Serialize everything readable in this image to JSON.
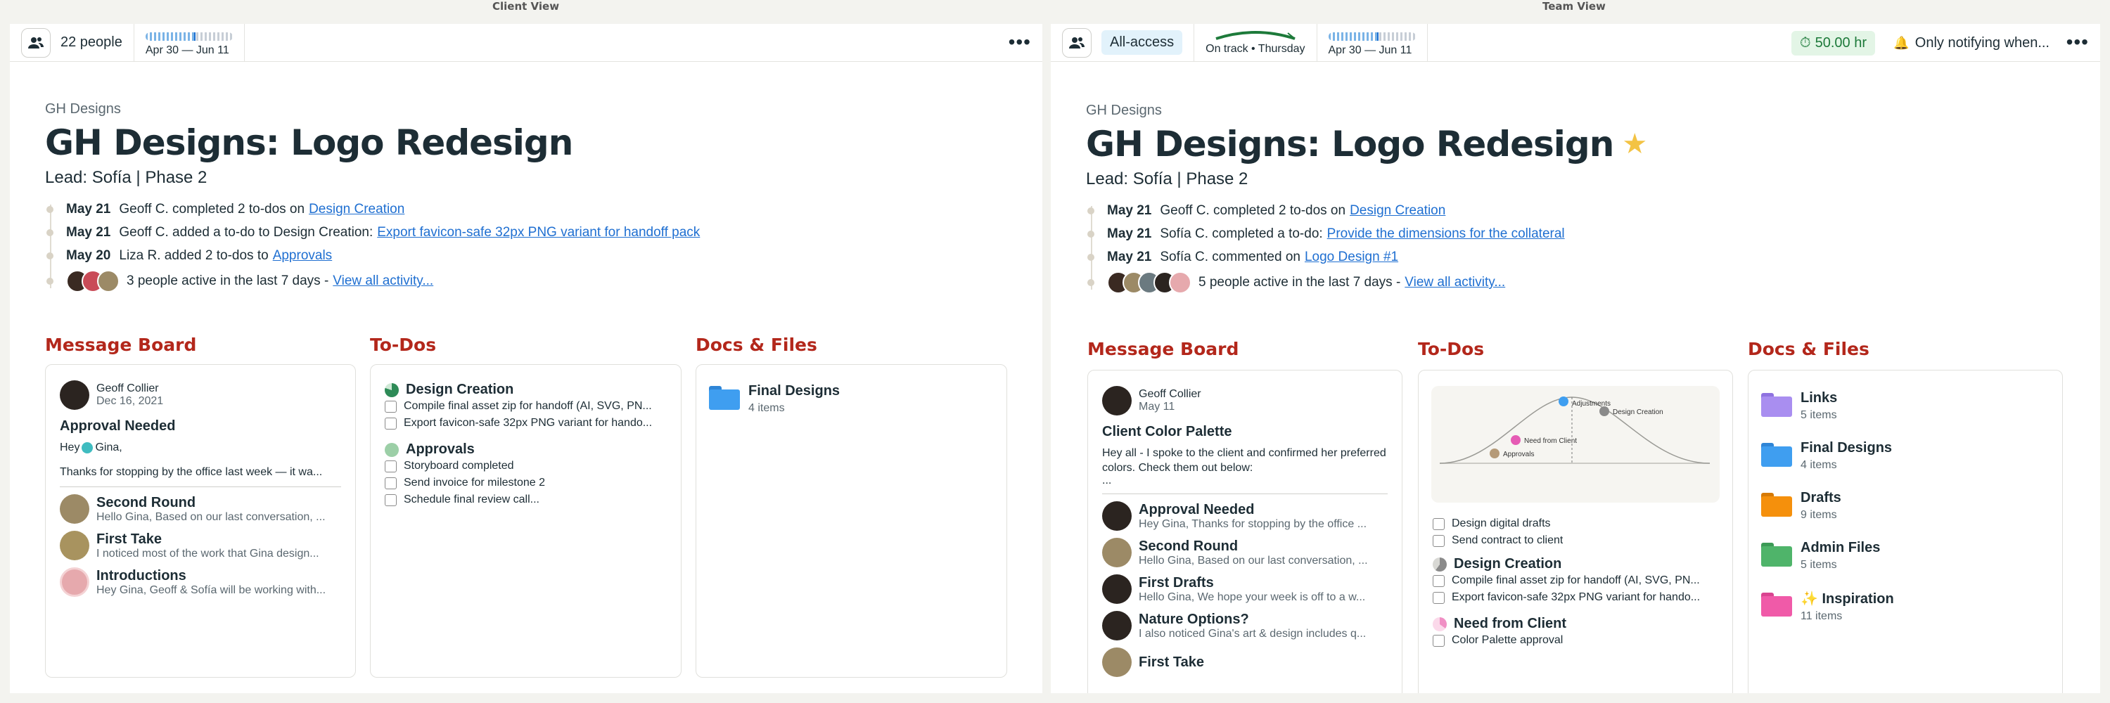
{
  "view_labels": {
    "client": "Client View",
    "team": "Team View"
  },
  "client": {
    "people": "22 people",
    "dates": "Apr 30 — Jun 11",
    "progress_fraction": 0.56,
    "company": "GH Designs",
    "title": "GH Designs: Logo Redesign",
    "lead": "Lead: Sofía | Phase 2",
    "activity": [
      {
        "date": "May 21",
        "text": "Geoff C. completed 2 to-dos on",
        "link": "Design Creation"
      },
      {
        "date": "May 21",
        "text": "Geoff C. added a to-do to Design Creation:",
        "link": "Export favicon-safe 32px PNG variant for handoff pack"
      },
      {
        "date": "May 20",
        "text": "Liza R. added 2 to-dos to",
        "link": "Approvals"
      }
    ],
    "active_text": "3 people active in the last 7 days -",
    "active_link": "View all activity...",
    "sections": {
      "messages": "Message Board",
      "todos": "To-Dos",
      "docs": "Docs & Files"
    },
    "featured_message": {
      "author": "Geoff Collier",
      "date": "Dec 16, 2021",
      "title": "Approval Needed",
      "greeting_a": "Hey",
      "greeting_b": "Gina,",
      "body": "Thanks for stopping by the office last week — it wa..."
    },
    "messages": [
      {
        "title": "Second Round",
        "snippet": "Hello Gina, Based on our last conversation, ..."
      },
      {
        "title": "First Take",
        "snippet": "I noticed most of the work that Gina design..."
      },
      {
        "title": "Introductions",
        "snippet": "Hey Gina, Geoff & Sofía will be working with..."
      }
    ],
    "todo_groups": [
      {
        "name": "Design Creation",
        "color": "#2e8b57",
        "items": [
          "Compile final asset zip for handoff (AI, SVG, PN...",
          "Export favicon-safe 32px PNG variant for hando..."
        ]
      },
      {
        "name": "Approvals",
        "color": "#9ccfa7",
        "items": [
          "Storyboard completed",
          "Send invoice for milestone 2",
          "Schedule final review call..."
        ]
      }
    ],
    "folders": [
      {
        "name": "Final Designs",
        "count": "4 items",
        "color": "#3f9ef0"
      }
    ]
  },
  "team": {
    "access": "All-access",
    "ontrack": "On track • Thursday",
    "dates": "Apr 30 — Jun 11",
    "progress_fraction": 0.56,
    "hours": "50.00 hr",
    "notify": "Only notifying when...",
    "company": "GH Designs",
    "title": "GH Designs: Logo Redesign",
    "lead": "Lead: Sofía | Phase 2",
    "activity": [
      {
        "date": "May 21",
        "text": "Geoff C. completed 2 to-dos on",
        "link": "Design Creation"
      },
      {
        "date": "May 21",
        "text": "Sofía C. completed a to-do:",
        "link": "Provide the dimensions for the collateral"
      },
      {
        "date": "May 21",
        "text": "Sofía C. commented on",
        "link": "Logo Design #1"
      }
    ],
    "active_text": "5 people active in the last 7 days -",
    "active_link": "View all activity...",
    "sections": {
      "messages": "Message Board",
      "todos": "To-Dos",
      "docs": "Docs & Files"
    },
    "featured_message": {
      "author": "Geoff Collier",
      "date": "May 11",
      "title": "Client Color Palette",
      "body": "Hey all - I spoke to the client and confirmed her preferred colors. Check them out below:",
      "more": "..."
    },
    "messages": [
      {
        "title": "Approval Needed",
        "snippet": "Hey Gina, Thanks for stopping by the office ..."
      },
      {
        "title": "Second Round",
        "snippet": "Hello Gina, Based on our last conversation, ..."
      },
      {
        "title": "First Drafts",
        "snippet": "Hello Gina, We hope your week is off to a w..."
      },
      {
        "title": "Nature Options?",
        "snippet": "I also noticed Gina's art & design includes q..."
      },
      {
        "title": "First Take",
        "snippet": ""
      }
    ],
    "hill_labels": {
      "adjustments": "Adjustments",
      "design_creation": "Design Creation",
      "need_from_client": "Need from Client",
      "approvals": "Approvals"
    },
    "loose_todos": [
      "Design digital drafts",
      "Send contract to client"
    ],
    "todo_groups": [
      {
        "name": "Design Creation",
        "color": "#8a8a8a",
        "items": [
          "Compile final asset zip for handoff (AI, SVG, PN...",
          "Export favicon-safe 32px PNG variant for hando..."
        ]
      },
      {
        "name": "Need from Client",
        "color": "#f08fc4",
        "items": [
          "Color Palette approval"
        ]
      }
    ],
    "folders": [
      {
        "name": "Links",
        "count": "5 items",
        "color": "#a98ef0"
      },
      {
        "name": "Final Designs",
        "count": "4 items",
        "color": "#3f9ef0"
      },
      {
        "name": "Drafts",
        "count": "9 items",
        "color": "#f5900c"
      },
      {
        "name": "Admin Files",
        "count": "5 items",
        "color": "#4fb46a"
      },
      {
        "name": "✨ Inspiration",
        "count": "11 items",
        "color": "#f05aa8"
      }
    ]
  },
  "icons": {
    "people": "people-icon",
    "timer": "stopwatch-icon",
    "bell": "bell-icon",
    "more": "more-icon",
    "star": "star-icon",
    "folder": "folder-icon"
  }
}
